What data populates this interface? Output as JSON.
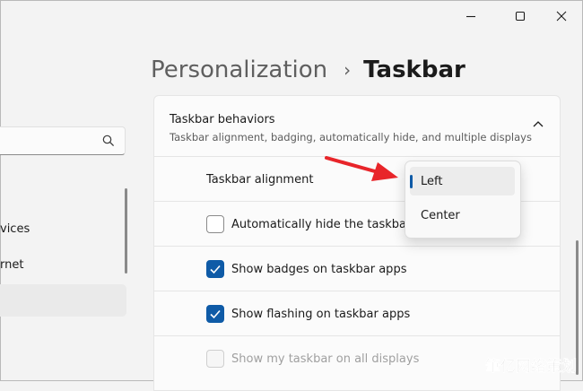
{
  "window": {
    "controls": [
      "minimize-icon",
      "maximize-icon",
      "close-icon"
    ]
  },
  "breadcrumb": {
    "parent": "Personalization",
    "separator": "›",
    "current": "Taskbar"
  },
  "nav": {
    "search_placeholder": "",
    "items": [
      {
        "label": "vices"
      },
      {
        "label": "rnet"
      },
      {
        "label": ""
      }
    ]
  },
  "section": {
    "title": "Taskbar behaviors",
    "subtitle": "Taskbar alignment, badging, automatically hide, and multiple displays",
    "rows": [
      {
        "label": "Taskbar alignment"
      },
      {
        "label": "Automatically hide the taskbar",
        "checked": false,
        "enabled": true
      },
      {
        "label": "Show badges on taskbar apps",
        "checked": true,
        "enabled": true
      },
      {
        "label": "Show flashing on taskbar apps",
        "checked": true,
        "enabled": true
      },
      {
        "label": "Show my taskbar on all displays",
        "checked": false,
        "enabled": false
      }
    ]
  },
  "alignment_dropdown": {
    "options": [
      "Left",
      "Center"
    ],
    "selected": "Left"
  },
  "colors": {
    "accent": "#0f5ba7",
    "annotation_arrow": "#e8252a",
    "window_bg": "#f3f3f3",
    "card_bg": "#fbfbfb"
  },
  "watermark": "筆亿网络策划"
}
